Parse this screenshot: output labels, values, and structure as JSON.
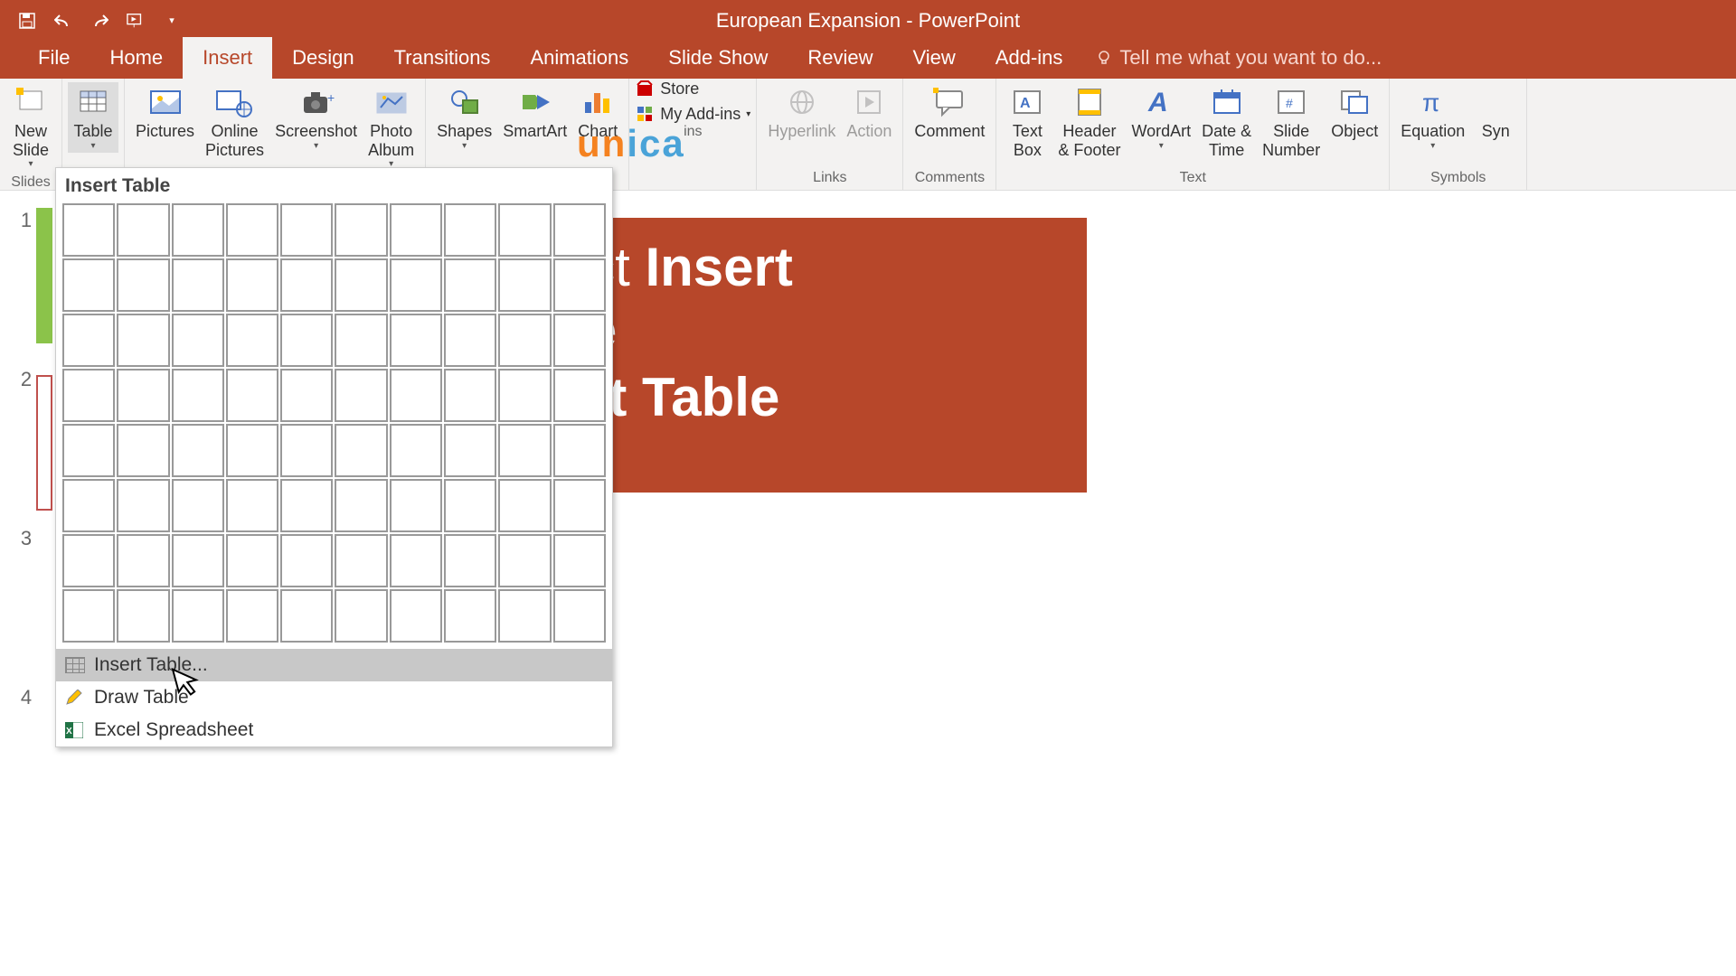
{
  "titlebar": {
    "title": "European Expansion - PowerPoint"
  },
  "tabs": {
    "file": "File",
    "home": "Home",
    "insert": "Insert",
    "design": "Design",
    "transitions": "Transitions",
    "animations": "Animations",
    "slideshow": "Slide Show",
    "review": "Review",
    "view": "View",
    "addins": "Add-ins",
    "tellme": "Tell me what you want to do..."
  },
  "ribbon": {
    "slides": {
      "new_slide": "New\nSlide",
      "group": "Slides"
    },
    "tables": {
      "table": "Table"
    },
    "images": {
      "pictures": "Pictures",
      "online_pictures": "Online\nPictures",
      "screenshot": "Screenshot",
      "photo_album": "Photo\nAlbum"
    },
    "illustrations": {
      "shapes": "Shapes",
      "smartart": "SmartArt",
      "chart": "Chart"
    },
    "addins": {
      "store": "Store",
      "myaddins": "My Add-ins",
      "group": "ins"
    },
    "links": {
      "hyperlink": "Hyperlink",
      "action": "Action",
      "group": "Links"
    },
    "comments": {
      "comment": "Comment",
      "group": "Comments"
    },
    "text": {
      "textbox": "Text\nBox",
      "headerfooter": "Header\n& Footer",
      "wordart": "WordArt",
      "datetime": "Date &\nTime",
      "slidenumber": "Slide\nNumber",
      "object": "Object",
      "group": "Text"
    },
    "symbols": {
      "equation": "Equation",
      "symbol": "Syn",
      "group": "Symbols"
    }
  },
  "table_dropdown": {
    "title": "Insert Table",
    "insert_table": "Insert Table...",
    "draw_table": "Draw Table",
    "excel": "Excel Spreadsheet"
  },
  "instruction": {
    "prefix": "Select",
    "bold1": "Insert",
    "line2": "Table",
    "line3": "Insert Table"
  },
  "thumbs": [
    "1",
    "2",
    "3",
    "4"
  ],
  "watermark": {
    "p1": "un",
    "p2": "ica"
  }
}
